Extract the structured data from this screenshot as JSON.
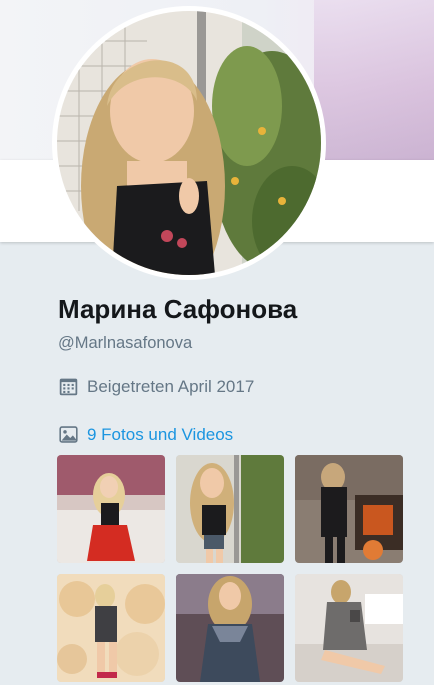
{
  "profile": {
    "name": "Марина Сафонова",
    "handle": "@Marlnasafonova",
    "joined": "Beigetreten April 2017",
    "media_link": "9 Fotos und Videos"
  },
  "icons": {
    "joined": "calendar-icon",
    "media": "image-icon"
  },
  "colors": {
    "background": "#e6ecf0",
    "link": "#1b95e0",
    "secondary_text": "#657786",
    "primary_text": "#14171a"
  }
}
